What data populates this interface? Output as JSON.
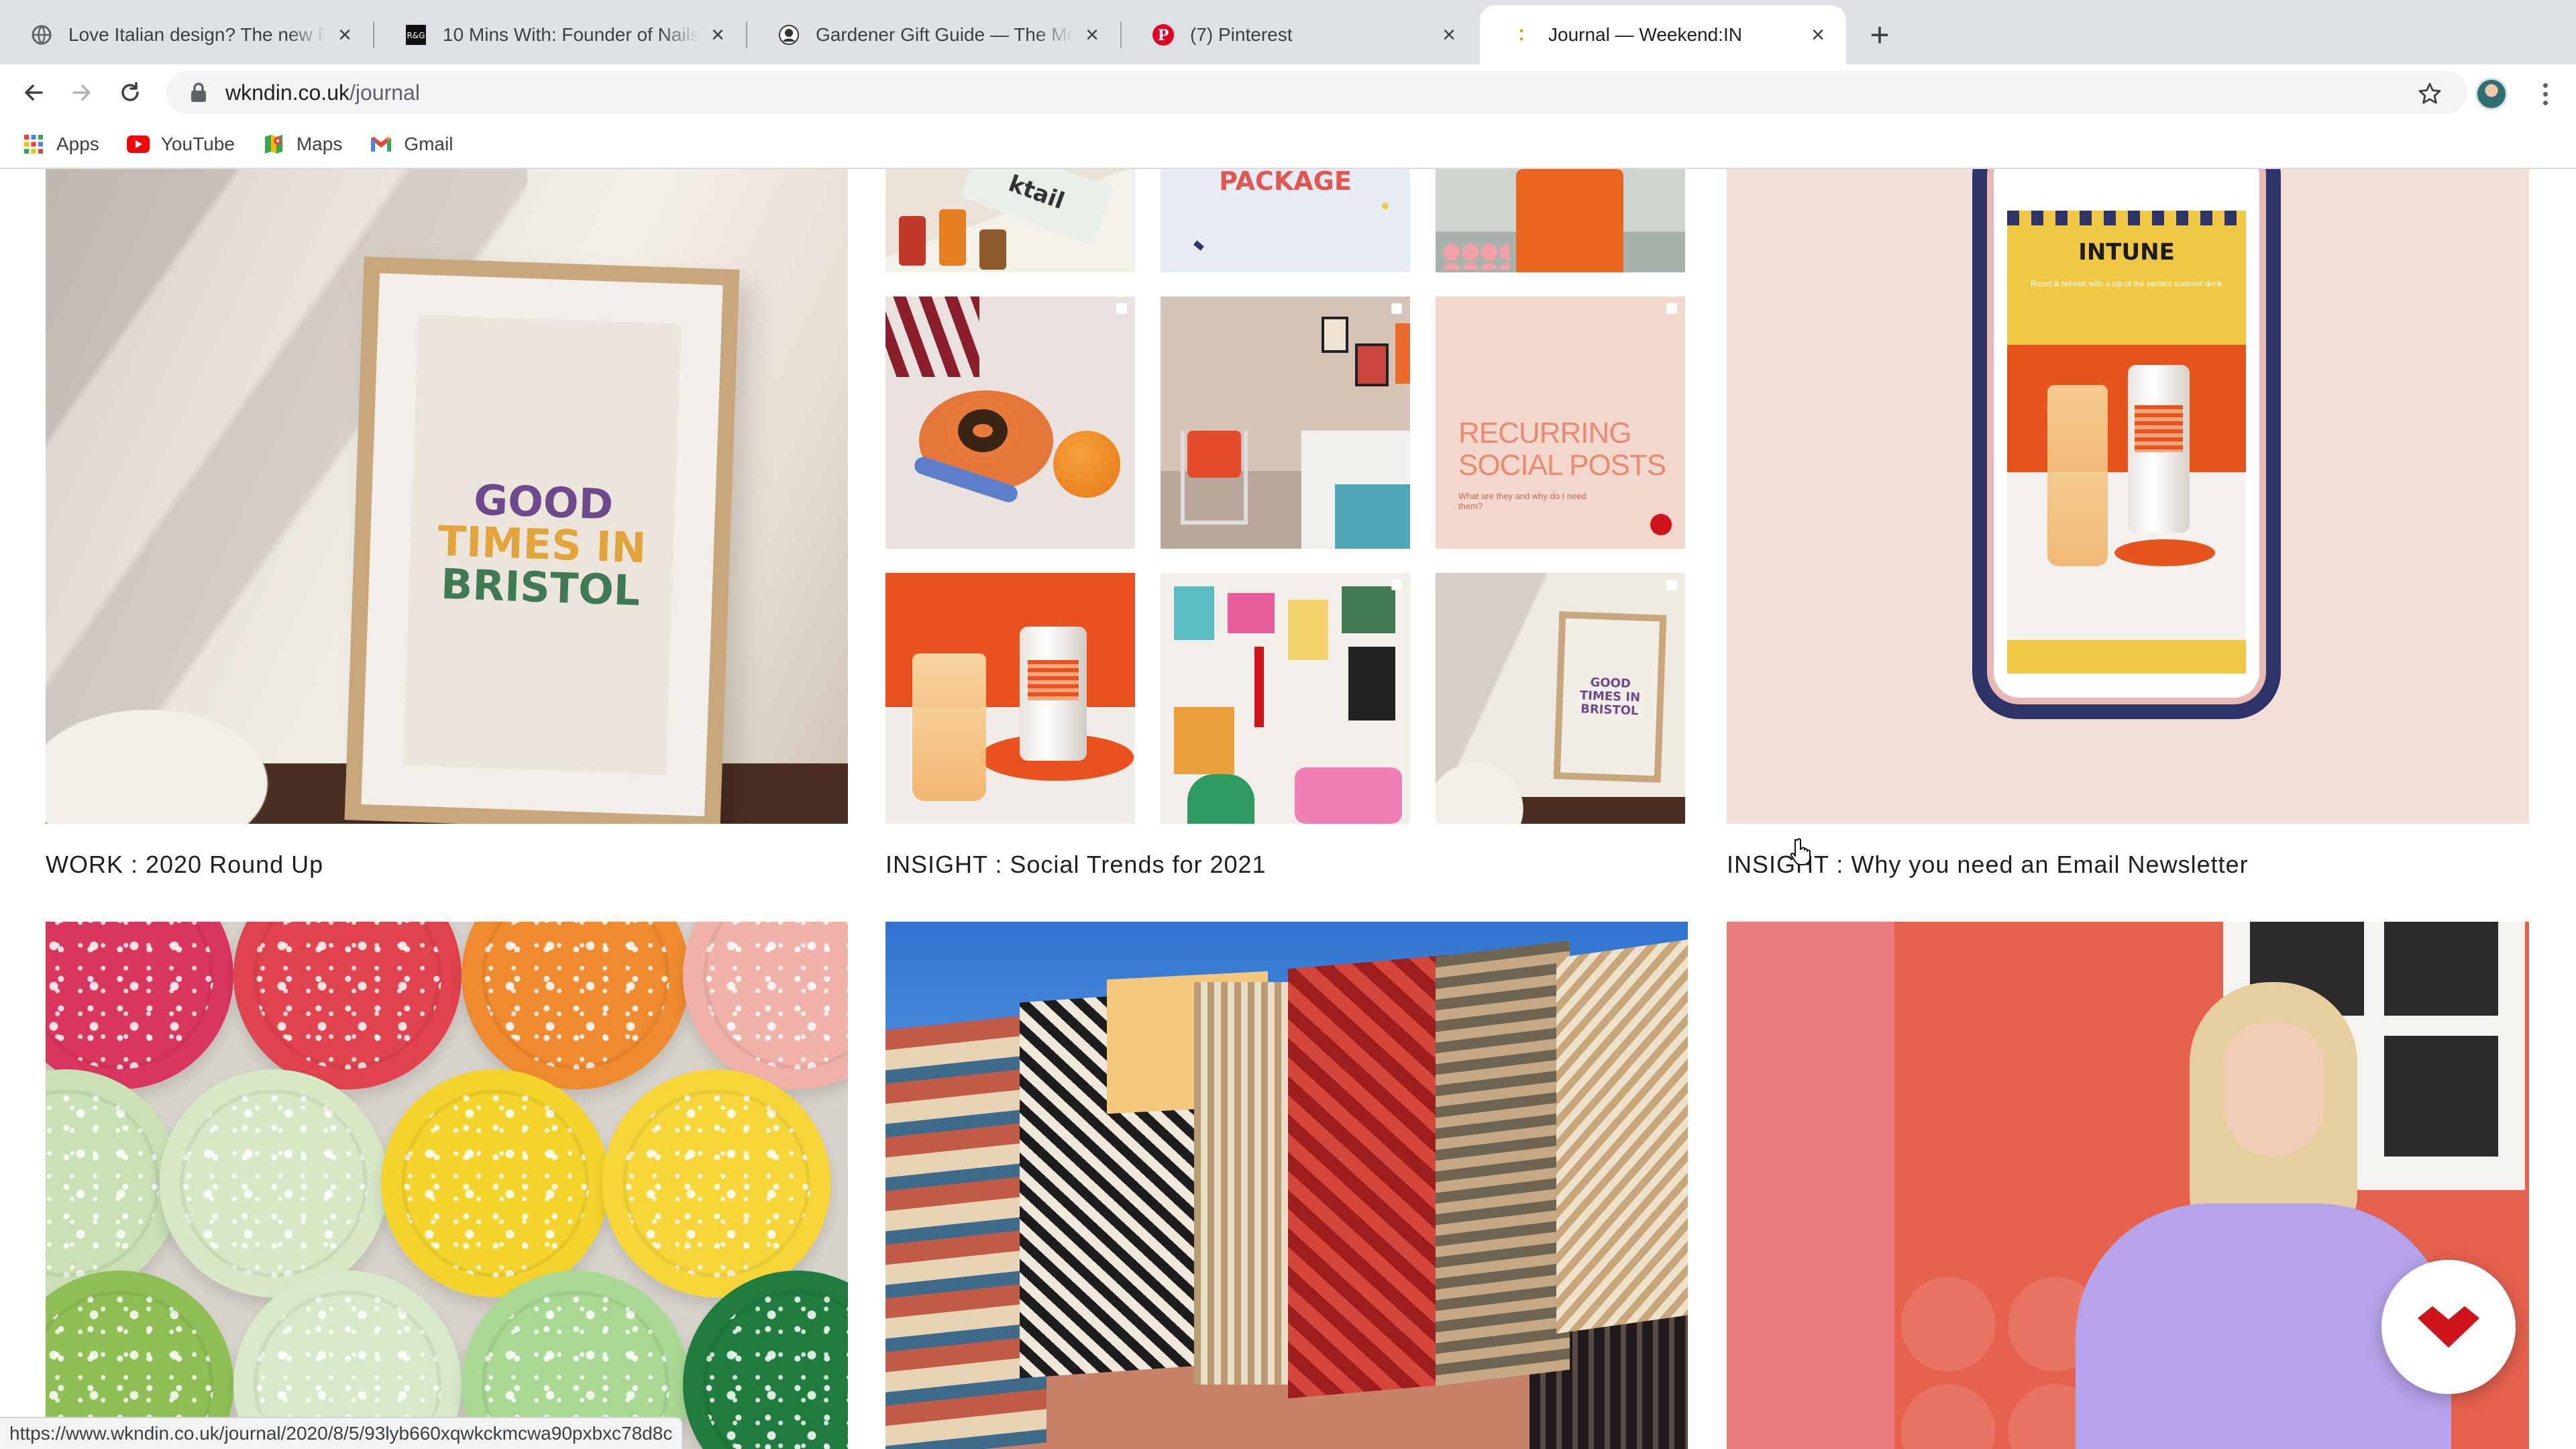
{
  "browser": {
    "tabs": [
      {
        "title": "Love Italian design? The new P",
        "favicon": "globe-icon",
        "active": false
      },
      {
        "title": "10 Mins With: Founder of Nails",
        "favicon": "rg-logo-icon",
        "active": false
      },
      {
        "title": "Gardener Gift Guide — The Mo",
        "favicon": "gardener-logo-icon",
        "active": false
      },
      {
        "title": "(7) Pinterest",
        "favicon": "pinterest-icon",
        "active": false
      },
      {
        "title": "Journal — Weekend:IN",
        "favicon": "weekendin-icon",
        "active": true
      }
    ],
    "address": {
      "host": "wkndin.co.uk",
      "path": "/journal"
    },
    "bookmarks": [
      {
        "label": "Apps",
        "icon": "apps-grid-icon"
      },
      {
        "label": "YouTube",
        "icon": "youtube-icon"
      },
      {
        "label": "Maps",
        "icon": "maps-icon"
      },
      {
        "label": "Gmail",
        "icon": "gmail-icon"
      }
    ],
    "status_url": "https://www.wkndin.co.uk/journal/2020/8/5/93lyb660xqwkckmcwa90pxbxc78d8c"
  },
  "journal": {
    "posts": [
      {
        "caption": "WORK : 2020 Round Up"
      },
      {
        "caption": "INSIGHT : Social Trends for 2021"
      },
      {
        "caption": "INSIGHT : Why you need an Email Newsletter"
      }
    ],
    "poster_text": {
      "line1": "GOOD",
      "line2": "TIMES IN",
      "line3": "BRISTOL"
    },
    "grid_text": {
      "package": "PACKAGE",
      "recurring": "RECURRING SOCIAL POSTS",
      "recurring_sub": "What are they and why do I need them?",
      "mini_poster": "GOOD TIMES IN BRISTOL",
      "cocktail": "ktail"
    },
    "phone_text": {
      "brand": "INTUNE",
      "tagline": "Reset & refresh with a sip of the perfect summer drink"
    }
  },
  "colors": {
    "accent_red": "#d0141c",
    "tab_strip": "#dee1e6",
    "omnibox": "#f1f3f4"
  }
}
